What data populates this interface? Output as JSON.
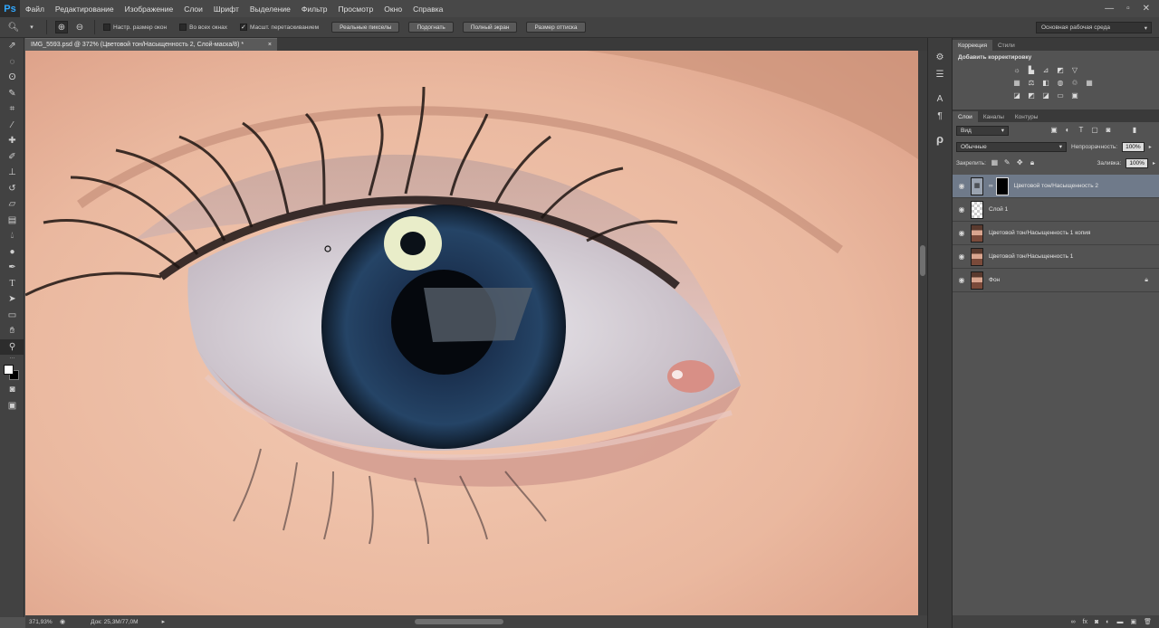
{
  "app": {
    "logo": "Ps",
    "menu": [
      "Файл",
      "Редактирование",
      "Изображение",
      "Слои",
      "Шрифт",
      "Выделение",
      "Фильтр",
      "Просмотр",
      "Окно",
      "Справка"
    ],
    "window_controls": [
      "—",
      "▫",
      "✕"
    ]
  },
  "options": {
    "checkboxes": [
      {
        "label": "Настр. размер окон",
        "checked": ""
      },
      {
        "label": "Во всех окнах",
        "checked": ""
      },
      {
        "label": "Масшт. перетаскиванием",
        "checked": "✓"
      }
    ],
    "buttons": [
      "Реальные пикселы",
      "Подогнать",
      "Полный экран",
      "Размер оттиска"
    ],
    "workspace": "Основная рабочая среда"
  },
  "document": {
    "tab_title": "IMG_5593.psd @ 372% (Цветовой тон/Насыщенность 2, Слой-маска/8) *",
    "tab_close": "×",
    "zoom": "371,93%",
    "doc_size": "Док: 25,3M/77,0M"
  },
  "panels": {
    "top_tabs": [
      "Коррекция",
      "Стили"
    ],
    "adjust_title": "Добавить корректировку",
    "layer_tabs": [
      "Слои",
      "Каналы",
      "Контуры"
    ],
    "filter_kind": "Вид",
    "blend_mode": "Обычные",
    "opacity_label": "Непрозрачность:",
    "opacity": "100%",
    "lock_label": "Закрепить:",
    "fill_label": "Заливка:",
    "fill": "100%",
    "layers": [
      {
        "name": "Цветовой тон/Насыщенность 2",
        "type": "adjustment",
        "selected": true
      },
      {
        "name": "Слой 1",
        "type": "transparent",
        "selected": false
      },
      {
        "name": "Цветовой тон/Насыщенность 1 копия",
        "type": "portrait",
        "selected": false
      },
      {
        "name": "Цветовой тон/Насыщенность 1",
        "type": "portrait",
        "selected": false
      },
      {
        "name": "Фон",
        "type": "portrait",
        "selected": false,
        "locked": true
      }
    ]
  }
}
